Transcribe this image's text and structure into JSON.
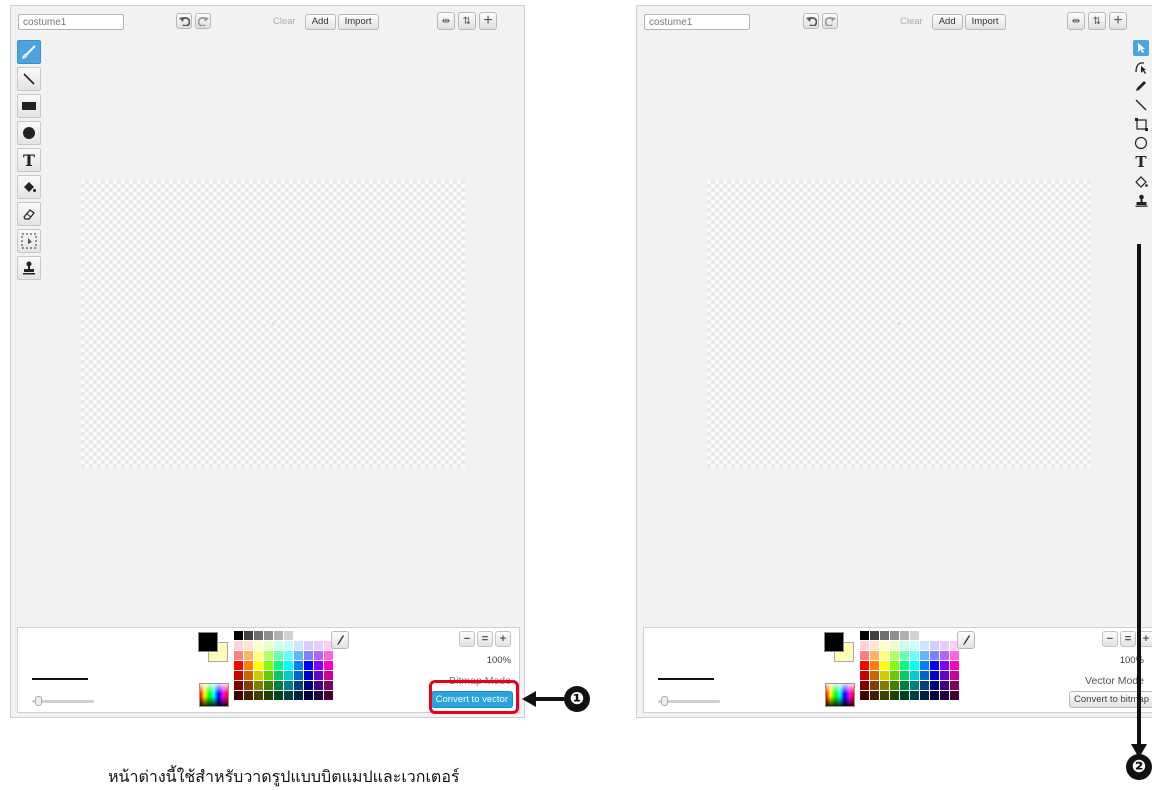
{
  "bitmap_editor": {
    "costume_name": "costume1",
    "buttons": {
      "clear": "Clear",
      "add": "Add",
      "import": "Import"
    },
    "zoom": "100%",
    "mode_label": "Bitmap Mode",
    "convert_button": "Convert to vector",
    "tools": [
      "brush-icon",
      "line-icon",
      "rectangle-icon",
      "ellipse-icon",
      "text-icon",
      "fill-bucket-icon",
      "eraser-icon",
      "select-icon",
      "stamp-icon"
    ],
    "active_tool": "brush-icon"
  },
  "vector_editor": {
    "costume_name": "costume1",
    "buttons": {
      "clear": "Clear",
      "add": "Add",
      "import": "Import"
    },
    "zoom": "100%",
    "mode_label": "Vector Mode",
    "convert_button": "Convert to bitmap",
    "tools": [
      "select-arrow-icon",
      "reshape-icon",
      "pencil-icon",
      "line-icon",
      "rectangle-icon",
      "ellipse-icon",
      "text-icon",
      "color-fill-icon",
      "duplicate-stamp-icon"
    ],
    "active_tool": "select-arrow-icon"
  },
  "palette_colors": [
    "#000000",
    "#404040",
    "#6e6e6e",
    "#8e8e8e",
    "#b0b0b0",
    "#d2d2d2",
    "#ffffff",
    "#ffffff",
    "#ffffff",
    "#ffffff",
    "#ffffff",
    "#ffd4d4",
    "#ffe6cc",
    "#ffffcc",
    "#e6ffcc",
    "#ccffe6",
    "#ccffff",
    "#cce6ff",
    "#d4ccff",
    "#e6ccff",
    "#ffccf2",
    "#ffffff",
    "#ff8080",
    "#ffb366",
    "#ffff80",
    "#b3ff66",
    "#66ffb3",
    "#66ffff",
    "#66b3ff",
    "#8080ff",
    "#b366ff",
    "#ff66d9",
    "#ffffff",
    "#ff0000",
    "#ff8000",
    "#ffff00",
    "#80ff00",
    "#00ff80",
    "#00ffff",
    "#0080ff",
    "#0000ff",
    "#8000ff",
    "#ff00bf",
    "#ffffff",
    "#cc0000",
    "#cc6600",
    "#cccc00",
    "#66cc00",
    "#00cc66",
    "#00cccc",
    "#0066cc",
    "#0000cc",
    "#6600cc",
    "#cc0099",
    "#ffffff",
    "#800000",
    "#804000",
    "#808000",
    "#408000",
    "#008040",
    "#008080",
    "#004080",
    "#000080",
    "#400080",
    "#800060",
    "#ffffff",
    "#400000",
    "#402000",
    "#404000",
    "#204000",
    "#004020",
    "#004040",
    "#002040",
    "#000040",
    "#200040",
    "#400030",
    "#ffffff"
  ],
  "colors": {
    "primary": "#000000",
    "secondary": "#fffcb7",
    "highlight": "#e8001c",
    "accent": "#2aa4dc"
  },
  "callouts": {
    "one": "❶",
    "two": "❷"
  },
  "caption": "หน้าต่างนี้ใช้สำหรับวาดรูปแบบบิตแมปและเวกเตอร์"
}
